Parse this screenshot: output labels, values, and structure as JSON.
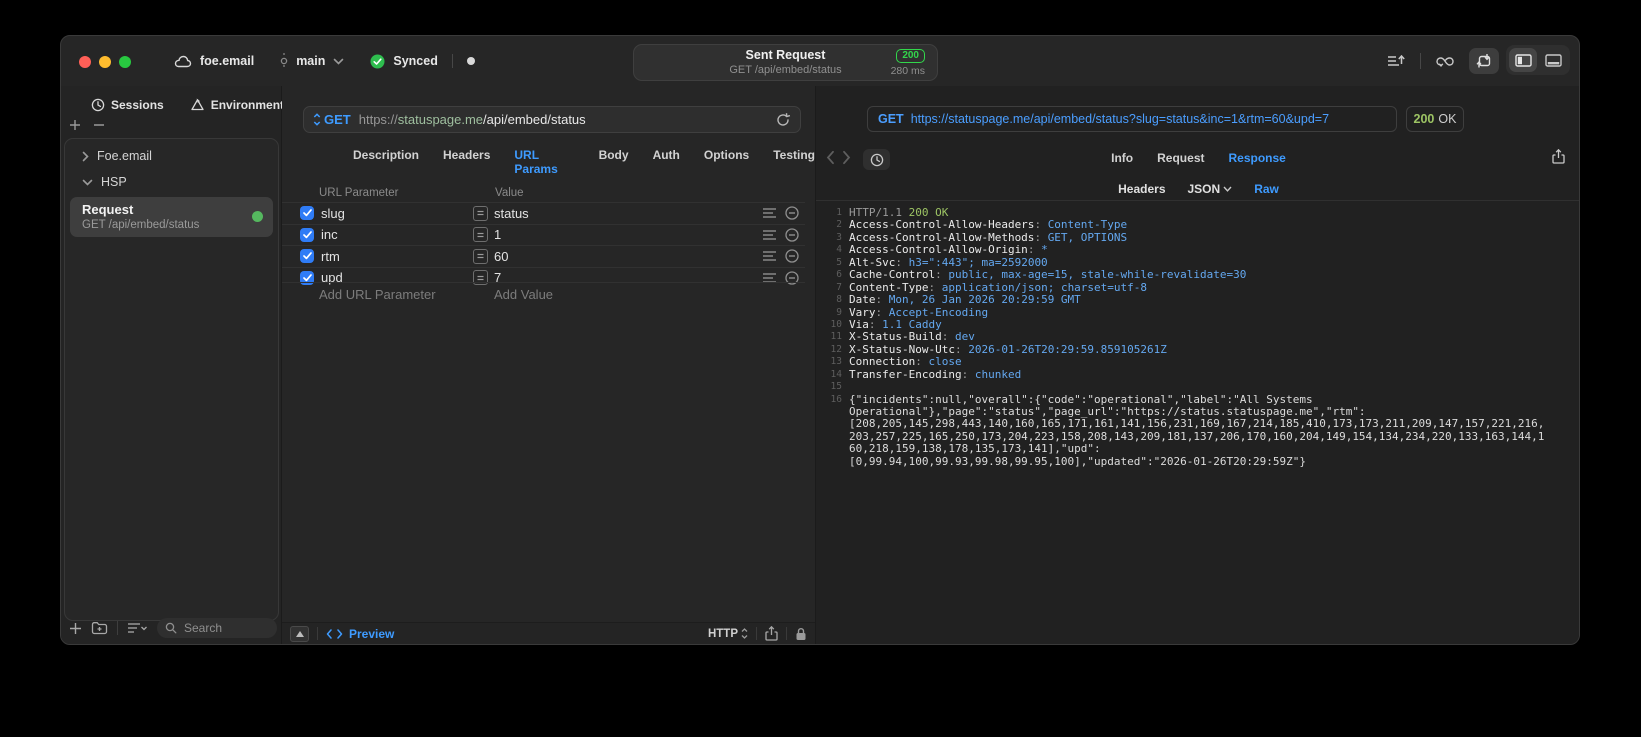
{
  "colors": {
    "accent_blue": "#3e9bff",
    "sync_green": "#32d74b",
    "code_green": "#9dc464",
    "code_value_blue": "#64a8f0",
    "checkbox_blue": "#2f7cf6",
    "host_green": "#9fbf9f"
  },
  "titlebar": {
    "project": "foe.email",
    "branch": "main",
    "sync_status": "Synced",
    "center": {
      "title": "Sent Request",
      "status_code": "200",
      "subtitle": "GET /api/embed/status",
      "duration": "280 ms"
    }
  },
  "sidebar": {
    "tabs": [
      {
        "label": "Sessions"
      },
      {
        "label": "Environments"
      }
    ],
    "tree": [
      {
        "label": "Foe.email"
      },
      {
        "label": "HSP"
      }
    ],
    "request_item": {
      "title": "Request",
      "subtitle": "GET /api/embed/status"
    },
    "search_placeholder": "Search"
  },
  "request_panel": {
    "method": "GET",
    "url": {
      "scheme": "https://",
      "host": "statuspage.me",
      "path": "/api/embed/status"
    },
    "tabs": [
      "Description",
      "Headers",
      "URL Params",
      "Body",
      "Auth",
      "Options",
      "Testing"
    ],
    "active_tab": "URL Params",
    "params": {
      "columns": {
        "name": "URL Parameter",
        "value": "Value"
      },
      "rows": [
        {
          "name": "slug",
          "value": "status",
          "checked": true
        },
        {
          "name": "inc",
          "value": "1",
          "checked": true
        },
        {
          "name": "rtm",
          "value": "60",
          "checked": true
        },
        {
          "name": "upd",
          "value": "7",
          "checked": true
        }
      ],
      "add_name": "Add URL Parameter",
      "add_value": "Add Value"
    },
    "footer": {
      "preview_label": "Preview",
      "protocol": "HTTP"
    }
  },
  "response_panel": {
    "method": "GET",
    "url": "https://statuspage.me/api/embed/status?slug=status&inc=1&rtm=60&upd=7",
    "status_code": "200",
    "status_text": "OK",
    "tabs": [
      "Info",
      "Request",
      "Response"
    ],
    "active_tab": "Response",
    "subtabs": [
      {
        "label": "Headers",
        "caret": false
      },
      {
        "label": "JSON",
        "caret": true
      },
      {
        "label": "Raw",
        "caret": false
      }
    ],
    "active_subtab": "Raw",
    "lines": [
      {
        "n": "1",
        "segs": [
          [
            "HTTP/1.1 ",
            "dim"
          ],
          [
            "200 OK",
            "green"
          ]
        ]
      },
      {
        "n": "2",
        "segs": [
          [
            "Access-Control-Allow-Headers",
            "key"
          ],
          [
            ": ",
            "dim"
          ],
          [
            "Content-Type",
            "val"
          ]
        ]
      },
      {
        "n": "3",
        "segs": [
          [
            "Access-Control-Allow-Methods",
            "key"
          ],
          [
            ": ",
            "dim"
          ],
          [
            "GET, OPTIONS",
            "val"
          ]
        ]
      },
      {
        "n": "4",
        "segs": [
          [
            "Access-Control-Allow-Origin",
            "key"
          ],
          [
            ": ",
            "dim"
          ],
          [
            "*",
            "val"
          ]
        ]
      },
      {
        "n": "5",
        "segs": [
          [
            "Alt-Svc",
            "key"
          ],
          [
            ": ",
            "dim"
          ],
          [
            "h3=\":443\"; ma=2592000",
            "val"
          ]
        ]
      },
      {
        "n": "6",
        "segs": [
          [
            "Cache-Control",
            "key"
          ],
          [
            ": ",
            "dim"
          ],
          [
            "public, max-age=15, stale-while-revalidate=30",
            "val"
          ]
        ]
      },
      {
        "n": "7",
        "segs": [
          [
            "Content-Type",
            "key"
          ],
          [
            ": ",
            "dim"
          ],
          [
            "application/json; charset=utf-8",
            "val"
          ]
        ]
      },
      {
        "n": "8",
        "segs": [
          [
            "Date",
            "key"
          ],
          [
            ": ",
            "dim"
          ],
          [
            "Mon, 26 Jan 2026 20:29:59 GMT",
            "val"
          ]
        ]
      },
      {
        "n": "9",
        "segs": [
          [
            "Vary",
            "key"
          ],
          [
            ": ",
            "dim"
          ],
          [
            "Accept-Encoding",
            "val"
          ]
        ]
      },
      {
        "n": "10",
        "segs": [
          [
            "Via",
            "key"
          ],
          [
            ": ",
            "dim"
          ],
          [
            "1.1 Caddy",
            "val"
          ]
        ]
      },
      {
        "n": "11",
        "segs": [
          [
            "X-Status-Build",
            "key"
          ],
          [
            ": ",
            "dim"
          ],
          [
            "dev",
            "val"
          ]
        ]
      },
      {
        "n": "12",
        "segs": [
          [
            "X-Status-Now-Utc",
            "key"
          ],
          [
            ": ",
            "dim"
          ],
          [
            "2026-01-26T20:29:59.859105261Z",
            "val"
          ]
        ]
      },
      {
        "n": "13",
        "segs": [
          [
            "Connection",
            "key"
          ],
          [
            ": ",
            "dim"
          ],
          [
            "close",
            "val"
          ]
        ]
      },
      {
        "n": "14",
        "segs": [
          [
            "Transfer-Encoding",
            "key"
          ],
          [
            ": ",
            "dim"
          ],
          [
            "chunked",
            "val"
          ]
        ]
      },
      {
        "n": "15",
        "segs": []
      },
      {
        "n": "16",
        "segs": [
          [
            "{\"incidents\":null,\"overall\":{\"code\":\"operational\",\"label\":\"All Systems",
            "plain"
          ]
        ]
      },
      {
        "n": "",
        "segs": [
          [
            "Operational\"},\"page\":\"status\",\"page_url\":\"https://status.statuspage.me\",\"rtm\":",
            "plain"
          ]
        ]
      },
      {
        "n": "",
        "segs": [
          [
            "[208,205,145,298,443,140,160,165,171,161,141,156,231,169,167,214,185,410,173,173,211,209,147,157,221,216,",
            "plain"
          ]
        ]
      },
      {
        "n": "",
        "segs": [
          [
            "203,257,225,165,250,173,204,223,158,208,143,209,181,137,206,170,160,204,149,154,134,234,220,133,163,144,1",
            "plain"
          ]
        ]
      },
      {
        "n": "",
        "segs": [
          [
            "60,218,159,138,178,135,173,141],\"upd\":",
            "plain"
          ]
        ]
      },
      {
        "n": "",
        "segs": [
          [
            "[0,99.94,100,99.93,99.98,99.95,100],\"updated\":\"2026-01-26T20:29:59Z\"}",
            "plain"
          ]
        ]
      }
    ]
  }
}
